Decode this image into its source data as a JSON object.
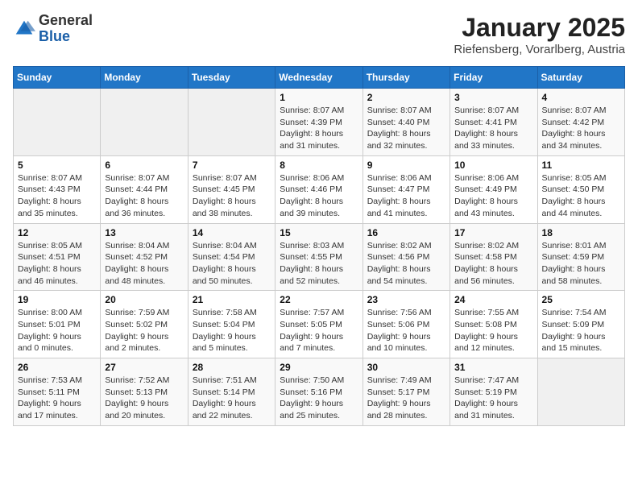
{
  "header": {
    "logo_general": "General",
    "logo_blue": "Blue",
    "title": "January 2025",
    "subtitle": "Riefensberg, Vorarlberg, Austria"
  },
  "weekdays": [
    "Sunday",
    "Monday",
    "Tuesday",
    "Wednesday",
    "Thursday",
    "Friday",
    "Saturday"
  ],
  "weeks": [
    [
      {
        "day": "",
        "sunrise": "",
        "sunset": "",
        "daylight": "",
        "empty": true
      },
      {
        "day": "",
        "sunrise": "",
        "sunset": "",
        "daylight": "",
        "empty": true
      },
      {
        "day": "",
        "sunrise": "",
        "sunset": "",
        "daylight": "",
        "empty": true
      },
      {
        "day": "1",
        "sunrise": "Sunrise: 8:07 AM",
        "sunset": "Sunset: 4:39 PM",
        "daylight": "Daylight: 8 hours and 31 minutes."
      },
      {
        "day": "2",
        "sunrise": "Sunrise: 8:07 AM",
        "sunset": "Sunset: 4:40 PM",
        "daylight": "Daylight: 8 hours and 32 minutes."
      },
      {
        "day": "3",
        "sunrise": "Sunrise: 8:07 AM",
        "sunset": "Sunset: 4:41 PM",
        "daylight": "Daylight: 8 hours and 33 minutes."
      },
      {
        "day": "4",
        "sunrise": "Sunrise: 8:07 AM",
        "sunset": "Sunset: 4:42 PM",
        "daylight": "Daylight: 8 hours and 34 minutes."
      }
    ],
    [
      {
        "day": "5",
        "sunrise": "Sunrise: 8:07 AM",
        "sunset": "Sunset: 4:43 PM",
        "daylight": "Daylight: 8 hours and 35 minutes."
      },
      {
        "day": "6",
        "sunrise": "Sunrise: 8:07 AM",
        "sunset": "Sunset: 4:44 PM",
        "daylight": "Daylight: 8 hours and 36 minutes."
      },
      {
        "day": "7",
        "sunrise": "Sunrise: 8:07 AM",
        "sunset": "Sunset: 4:45 PM",
        "daylight": "Daylight: 8 hours and 38 minutes."
      },
      {
        "day": "8",
        "sunrise": "Sunrise: 8:06 AM",
        "sunset": "Sunset: 4:46 PM",
        "daylight": "Daylight: 8 hours and 39 minutes."
      },
      {
        "day": "9",
        "sunrise": "Sunrise: 8:06 AM",
        "sunset": "Sunset: 4:47 PM",
        "daylight": "Daylight: 8 hours and 41 minutes."
      },
      {
        "day": "10",
        "sunrise": "Sunrise: 8:06 AM",
        "sunset": "Sunset: 4:49 PM",
        "daylight": "Daylight: 8 hours and 43 minutes."
      },
      {
        "day": "11",
        "sunrise": "Sunrise: 8:05 AM",
        "sunset": "Sunset: 4:50 PM",
        "daylight": "Daylight: 8 hours and 44 minutes."
      }
    ],
    [
      {
        "day": "12",
        "sunrise": "Sunrise: 8:05 AM",
        "sunset": "Sunset: 4:51 PM",
        "daylight": "Daylight: 8 hours and 46 minutes."
      },
      {
        "day": "13",
        "sunrise": "Sunrise: 8:04 AM",
        "sunset": "Sunset: 4:52 PM",
        "daylight": "Daylight: 8 hours and 48 minutes."
      },
      {
        "day": "14",
        "sunrise": "Sunrise: 8:04 AM",
        "sunset": "Sunset: 4:54 PM",
        "daylight": "Daylight: 8 hours and 50 minutes."
      },
      {
        "day": "15",
        "sunrise": "Sunrise: 8:03 AM",
        "sunset": "Sunset: 4:55 PM",
        "daylight": "Daylight: 8 hours and 52 minutes."
      },
      {
        "day": "16",
        "sunrise": "Sunrise: 8:02 AM",
        "sunset": "Sunset: 4:56 PM",
        "daylight": "Daylight: 8 hours and 54 minutes."
      },
      {
        "day": "17",
        "sunrise": "Sunrise: 8:02 AM",
        "sunset": "Sunset: 4:58 PM",
        "daylight": "Daylight: 8 hours and 56 minutes."
      },
      {
        "day": "18",
        "sunrise": "Sunrise: 8:01 AM",
        "sunset": "Sunset: 4:59 PM",
        "daylight": "Daylight: 8 hours and 58 minutes."
      }
    ],
    [
      {
        "day": "19",
        "sunrise": "Sunrise: 8:00 AM",
        "sunset": "Sunset: 5:01 PM",
        "daylight": "Daylight: 9 hours and 0 minutes."
      },
      {
        "day": "20",
        "sunrise": "Sunrise: 7:59 AM",
        "sunset": "Sunset: 5:02 PM",
        "daylight": "Daylight: 9 hours and 2 minutes."
      },
      {
        "day": "21",
        "sunrise": "Sunrise: 7:58 AM",
        "sunset": "Sunset: 5:04 PM",
        "daylight": "Daylight: 9 hours and 5 minutes."
      },
      {
        "day": "22",
        "sunrise": "Sunrise: 7:57 AM",
        "sunset": "Sunset: 5:05 PM",
        "daylight": "Daylight: 9 hours and 7 minutes."
      },
      {
        "day": "23",
        "sunrise": "Sunrise: 7:56 AM",
        "sunset": "Sunset: 5:06 PM",
        "daylight": "Daylight: 9 hours and 10 minutes."
      },
      {
        "day": "24",
        "sunrise": "Sunrise: 7:55 AM",
        "sunset": "Sunset: 5:08 PM",
        "daylight": "Daylight: 9 hours and 12 minutes."
      },
      {
        "day": "25",
        "sunrise": "Sunrise: 7:54 AM",
        "sunset": "Sunset: 5:09 PM",
        "daylight": "Daylight: 9 hours and 15 minutes."
      }
    ],
    [
      {
        "day": "26",
        "sunrise": "Sunrise: 7:53 AM",
        "sunset": "Sunset: 5:11 PM",
        "daylight": "Daylight: 9 hours and 17 minutes."
      },
      {
        "day": "27",
        "sunrise": "Sunrise: 7:52 AM",
        "sunset": "Sunset: 5:13 PM",
        "daylight": "Daylight: 9 hours and 20 minutes."
      },
      {
        "day": "28",
        "sunrise": "Sunrise: 7:51 AM",
        "sunset": "Sunset: 5:14 PM",
        "daylight": "Daylight: 9 hours and 22 minutes."
      },
      {
        "day": "29",
        "sunrise": "Sunrise: 7:50 AM",
        "sunset": "Sunset: 5:16 PM",
        "daylight": "Daylight: 9 hours and 25 minutes."
      },
      {
        "day": "30",
        "sunrise": "Sunrise: 7:49 AM",
        "sunset": "Sunset: 5:17 PM",
        "daylight": "Daylight: 9 hours and 28 minutes."
      },
      {
        "day": "31",
        "sunrise": "Sunrise: 7:47 AM",
        "sunset": "Sunset: 5:19 PM",
        "daylight": "Daylight: 9 hours and 31 minutes."
      },
      {
        "day": "",
        "sunrise": "",
        "sunset": "",
        "daylight": "",
        "empty": true
      }
    ]
  ]
}
